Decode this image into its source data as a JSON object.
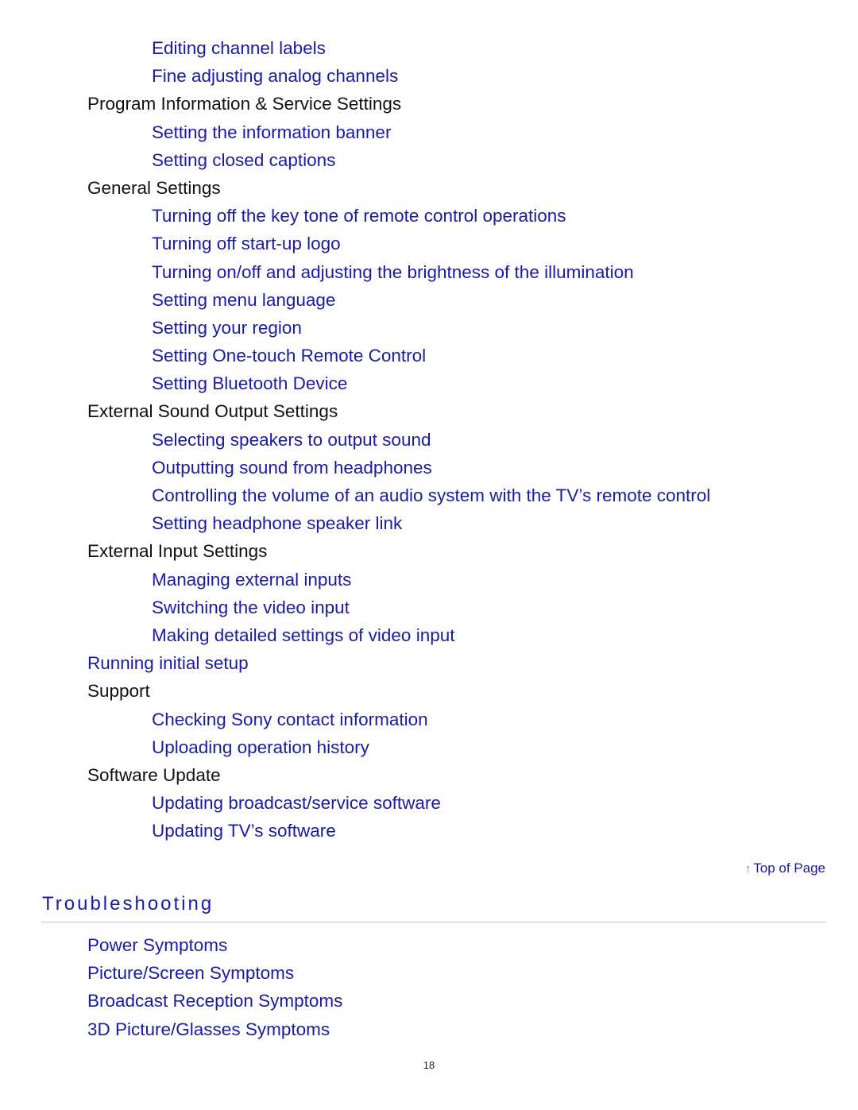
{
  "toc": [
    {
      "level": 2,
      "type": "link",
      "label": "Editing channel labels"
    },
    {
      "level": 2,
      "type": "link",
      "label": "Fine adjusting analog channels"
    },
    {
      "level": 1,
      "type": "heading",
      "label": "Program Information & Service Settings"
    },
    {
      "level": 2,
      "type": "link",
      "label": "Setting the information banner"
    },
    {
      "level": 2,
      "type": "link",
      "label": "Setting closed captions"
    },
    {
      "level": 1,
      "type": "heading",
      "label": "General Settings"
    },
    {
      "level": 2,
      "type": "link",
      "label": "Turning off the key tone of remote control operations"
    },
    {
      "level": 2,
      "type": "link",
      "label": "Turning off start-up logo"
    },
    {
      "level": 2,
      "type": "link",
      "label": "Turning on/off and adjusting the brightness of the illumination"
    },
    {
      "level": 2,
      "type": "link",
      "label": "Setting menu language"
    },
    {
      "level": 2,
      "type": "link",
      "label": "Setting your region"
    },
    {
      "level": 2,
      "type": "link",
      "label": "Setting One-touch Remote Control"
    },
    {
      "level": 2,
      "type": "link",
      "label": "Setting Bluetooth Device"
    },
    {
      "level": 1,
      "type": "heading",
      "label": "External Sound Output Settings"
    },
    {
      "level": 2,
      "type": "link",
      "label": "Selecting speakers to output sound"
    },
    {
      "level": 2,
      "type": "link",
      "label": "Outputting sound from headphones"
    },
    {
      "level": 2,
      "type": "link",
      "label": "Controlling the volume of an audio system with the TV’s remote control"
    },
    {
      "level": 2,
      "type": "link",
      "label": "Setting headphone speaker link"
    },
    {
      "level": 1,
      "type": "heading",
      "label": "External Input Settings"
    },
    {
      "level": 2,
      "type": "link",
      "label": "Managing external inputs"
    },
    {
      "level": 2,
      "type": "link",
      "label": "Switching the video input"
    },
    {
      "level": 2,
      "type": "link",
      "label": "Making detailed settings of video input"
    },
    {
      "level": 1,
      "type": "link",
      "label": "Running initial setup"
    },
    {
      "level": 1,
      "type": "heading",
      "label": "Support"
    },
    {
      "level": 2,
      "type": "link",
      "label": "Checking Sony contact information"
    },
    {
      "level": 2,
      "type": "link",
      "label": "Uploading operation history"
    },
    {
      "level": 1,
      "type": "heading",
      "label": "Software Update"
    },
    {
      "level": 2,
      "type": "link",
      "label": "Updating broadcast/service software"
    },
    {
      "level": 2,
      "type": "link",
      "label": "Updating TV’s software"
    }
  ],
  "top_of_page": {
    "icon": "up-arrow-icon",
    "arrow_glyph": "↑",
    "label": "Top of Page"
  },
  "troubleshooting": {
    "title": "Troubleshooting",
    "items": [
      {
        "label": "Power Symptoms"
      },
      {
        "label": "Picture/Screen Symptoms"
      },
      {
        "label": "Broadcast Reception Symptoms"
      },
      {
        "label": "3D Picture/Glasses Symptoms"
      }
    ]
  },
  "page_number": "18",
  "colors": {
    "link": "#1a1aa8",
    "text": "#111111",
    "rule": "#c4c4c4"
  }
}
